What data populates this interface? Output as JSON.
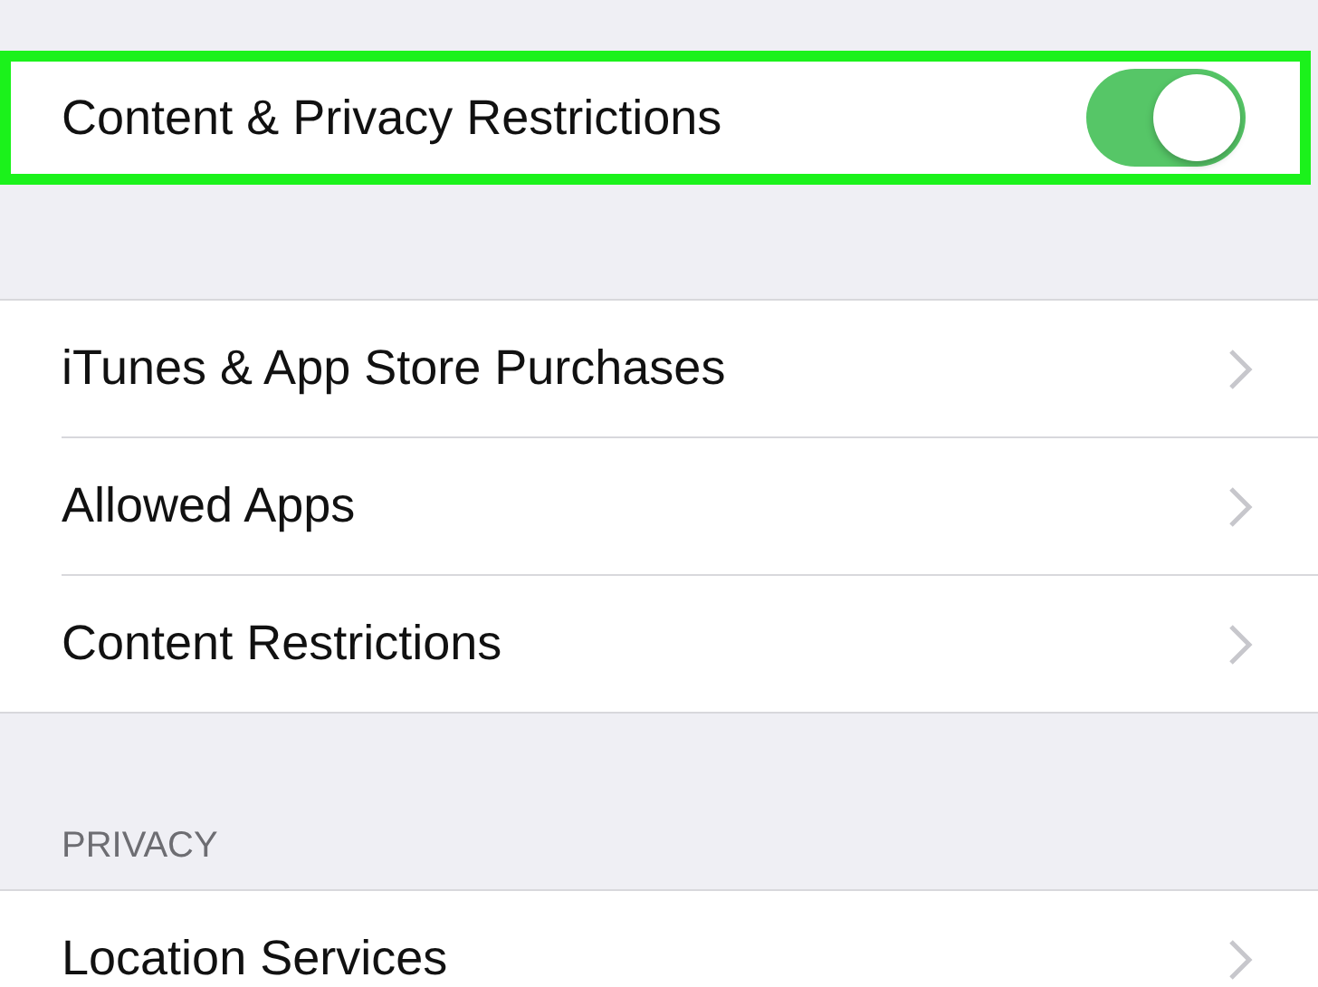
{
  "top_row": {
    "label": "Content & Privacy Restrictions",
    "on": true,
    "highlighted": true
  },
  "settings": [
    {
      "label": "iTunes & App Store Purchases"
    },
    {
      "label": "Allowed Apps"
    },
    {
      "label": "Content Restrictions"
    }
  ],
  "privacy": {
    "header": "PRIVACY",
    "items": [
      {
        "label": "Location Services"
      }
    ]
  }
}
